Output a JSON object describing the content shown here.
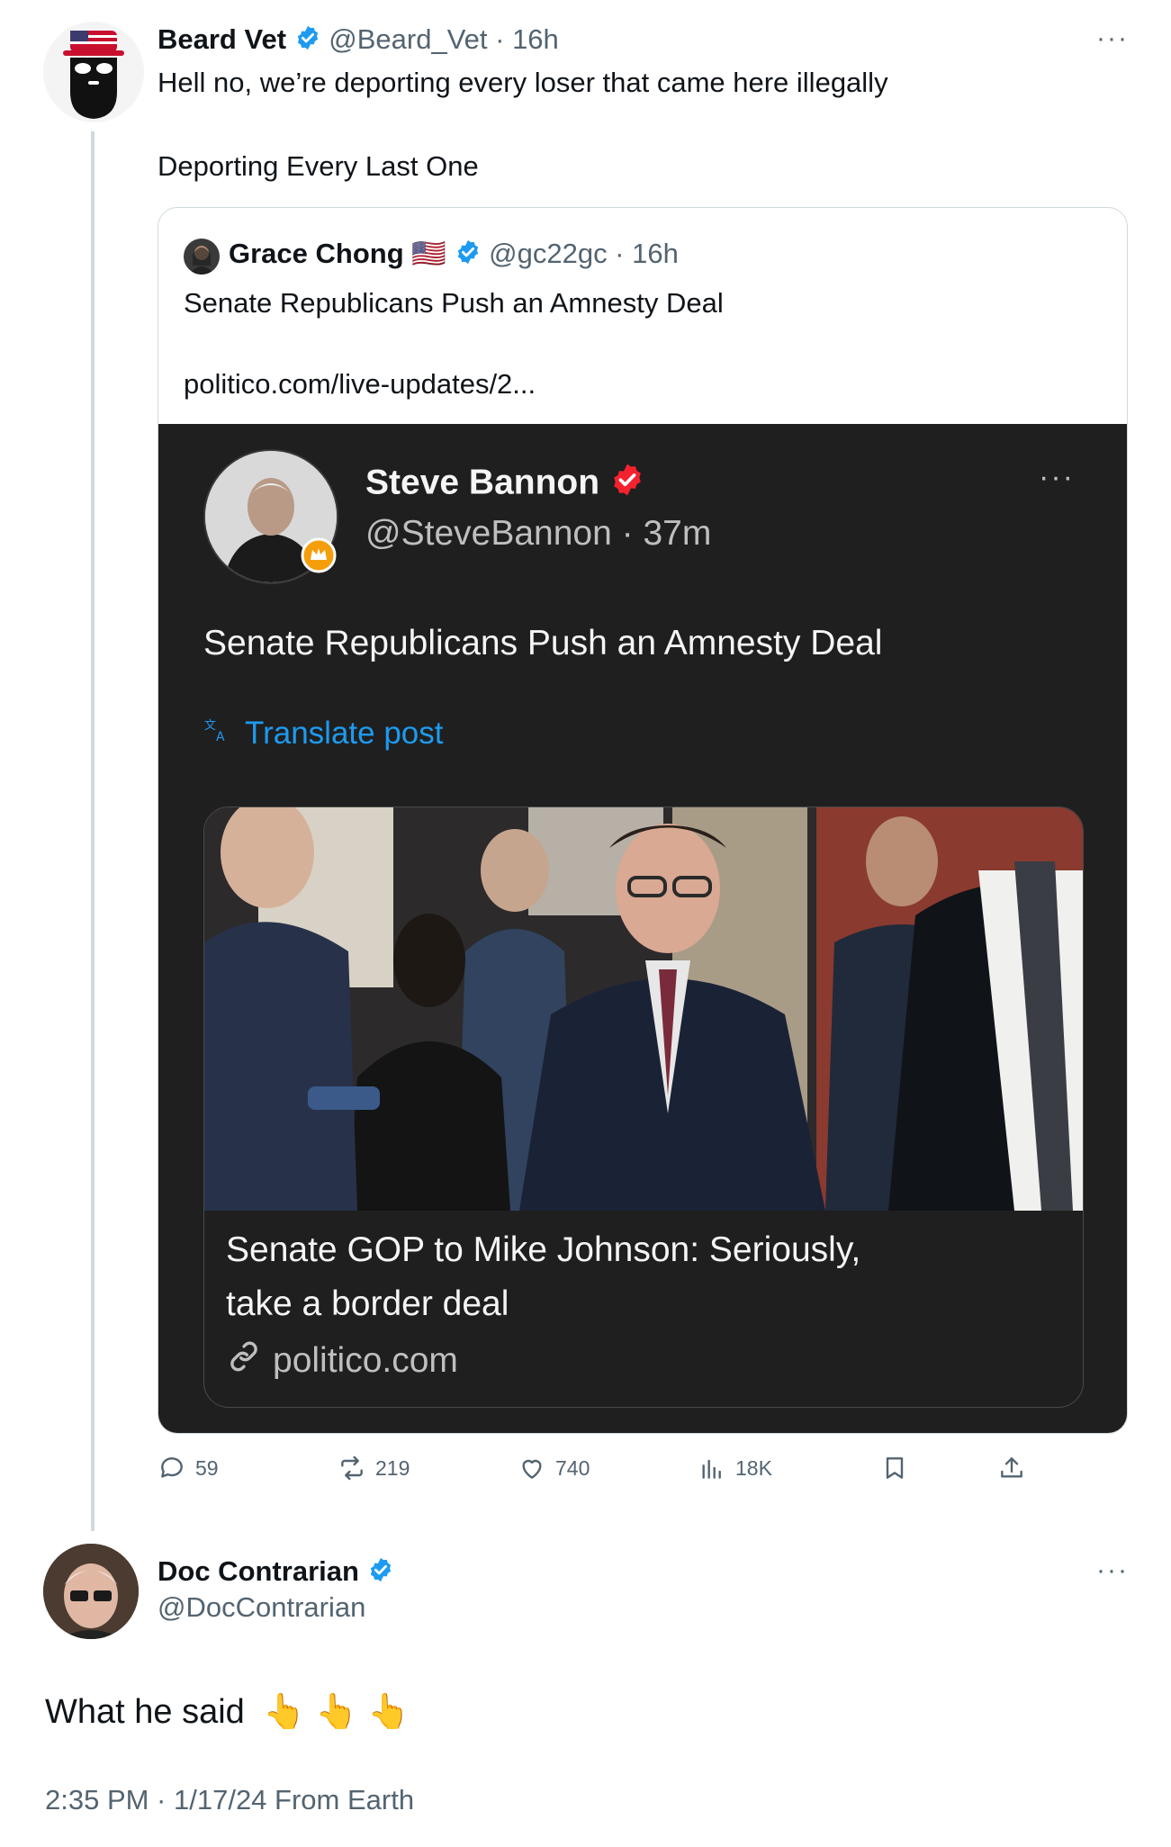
{
  "main_post": {
    "author_name": "Beard Vet",
    "handle_time": "@Beard_Vet · 16h",
    "text_line1": "Hell no, we’re deporting every loser that came here illegally",
    "text_line2": "Deporting Every Last One",
    "more_icon": "more-horizontal-icon"
  },
  "quoted_post": {
    "author_name": "Grace Chong",
    "flag": "🇺🇸",
    "handle_time": "@gc22gc · 16h",
    "text": "Senate Republicans Push an Amnesty Deal",
    "link": "politico.com/live-updates/2..."
  },
  "embedded_screenshot": {
    "author_name": "Steve Bannon",
    "handle_time": "@SteveBannon · 37m",
    "text": "Senate Republicans Push an Amnesty Deal",
    "translate_label": "Translate post",
    "card_headline_line1": "Senate GOP to Mike Johnson: Seriously,",
    "card_headline_line2": "take a border deal",
    "card_domain": "politico.com",
    "colors": {
      "background": "#1f1f1f",
      "link_blue": "#1d9bf0",
      "verified_red": "#f4212e"
    }
  },
  "actions": {
    "replies": "59",
    "reposts": "219",
    "likes": "740",
    "views": "18K"
  },
  "reply_post": {
    "author_name": "Doc Contrarian",
    "handle": "@DocContrarian",
    "text": "What he said",
    "emojis": "👆 👆 👆",
    "meta": "2:35 PM · 1/17/24 From Earth"
  },
  "colors": {
    "verified_blue": "#1d9bf0",
    "muted": "#536471",
    "border": "#cfd9de"
  }
}
